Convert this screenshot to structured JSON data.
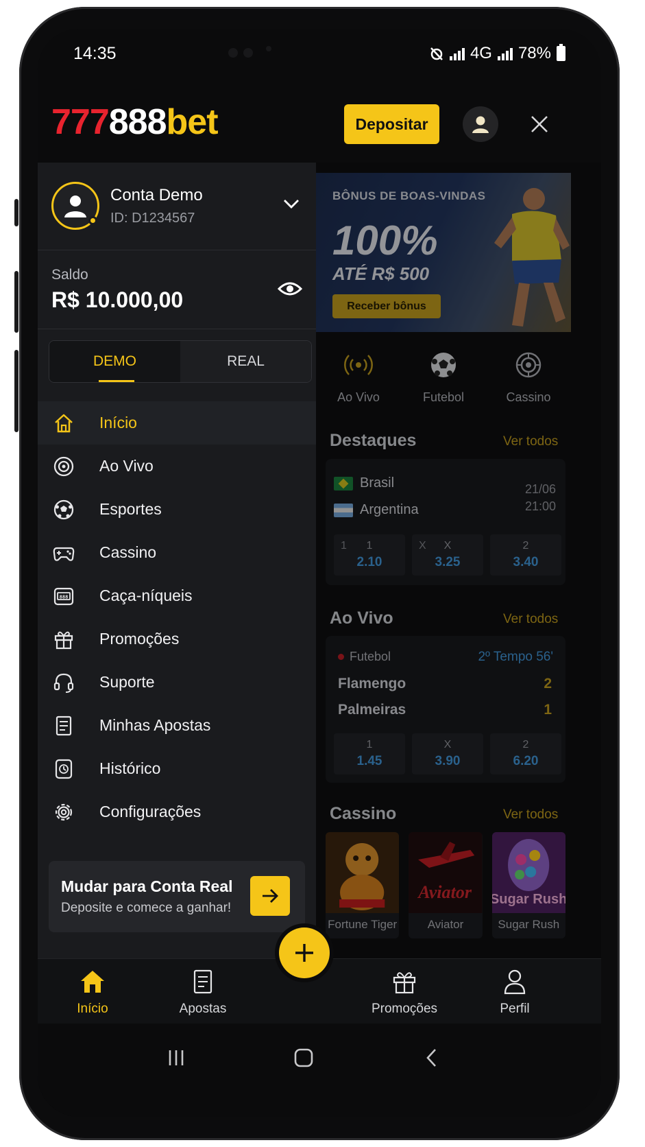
{
  "status_bar": {
    "time": "14:35",
    "network": "4G",
    "battery": "78%"
  },
  "header": {
    "logo_part1": "777",
    "logo_part2": "888",
    "logo_part3": "bet",
    "deposit_label": "Depositar"
  },
  "account": {
    "name": "Conta Demo",
    "id": "ID: D1234567"
  },
  "balance": {
    "label": "Saldo",
    "value": "R$ 10.000,00"
  },
  "mode_tabs": [
    {
      "label": "DEMO",
      "active": true
    },
    {
      "label": "REAL",
      "active": false
    }
  ],
  "menu": [
    {
      "label": "Início",
      "icon": "home-icon",
      "active": true
    },
    {
      "label": "Ao Vivo",
      "icon": "live-icon"
    },
    {
      "label": "Esportes",
      "icon": "soccer-ball-icon"
    },
    {
      "label": "Cassino",
      "icon": "gamepad-icon"
    },
    {
      "label": "Caça-níqueis",
      "icon": "slot-machine-icon"
    },
    {
      "label": "Promoções",
      "icon": "gift-icon"
    },
    {
      "label": "Suporte",
      "icon": "headset-icon"
    },
    {
      "label": "Minhas Apostas",
      "icon": "document-icon"
    },
    {
      "label": "Histórico",
      "icon": "history-icon"
    },
    {
      "label": "Configurações",
      "icon": "gear-icon"
    }
  ],
  "cta": {
    "title": "Mudar para Conta Real",
    "subtitle": "Deposite e comece a ganhar!"
  },
  "banner": {
    "line1": "BÔNUS DE BOAS-VINDAS",
    "line2": "100%",
    "line3": "ATÉ R$ 500",
    "button": "Receber bônus"
  },
  "quick_links": [
    {
      "label": "Ao Vivo",
      "icon": "live-icon"
    },
    {
      "label": "Futebol",
      "icon": "soccer-ball-icon"
    },
    {
      "label": "Cassino",
      "icon": "roulette-icon"
    }
  ],
  "highlights": {
    "title": "Destaques",
    "link": "Ver todos",
    "team1": "Brasil",
    "team2": "Argentina",
    "date": "21/06",
    "time": "21:00",
    "odds": [
      {
        "key": "1",
        "value": "2.10"
      },
      {
        "key": "X",
        "value": "3.25"
      },
      {
        "key": "2",
        "value": "3.40"
      }
    ],
    "odds_left_labels": [
      "1",
      "X"
    ]
  },
  "live": {
    "title": "Ao Vivo",
    "link": "Ver todos",
    "sport": "Futebol",
    "period": "2º Tempo 56'",
    "team1": "Flamengo",
    "score1": "2",
    "team2": "Palmeiras",
    "score2": "1",
    "odds": [
      {
        "key": "1",
        "value": "1.45"
      },
      {
        "key": "X",
        "value": "3.90"
      },
      {
        "key": "2",
        "value": "6.20"
      }
    ]
  },
  "casino": {
    "title": "Cassino",
    "link": "Ver todos",
    "games": [
      {
        "label": "Fortune Tiger"
      },
      {
        "label": "Aviator"
      },
      {
        "label": "Sugar Rush"
      }
    ]
  },
  "bottom_nav": [
    {
      "label": "Início",
      "icon": "home-icon",
      "active": true
    },
    {
      "label": "Apostas",
      "icon": "document-icon"
    },
    {
      "label": "Promoções",
      "icon": "gift-icon"
    },
    {
      "label": "Perfil",
      "icon": "user-icon"
    }
  ],
  "colors": {
    "accent": "#f5c518",
    "brand_red": "#e8232e",
    "odds_blue": "#3f8fcf"
  }
}
